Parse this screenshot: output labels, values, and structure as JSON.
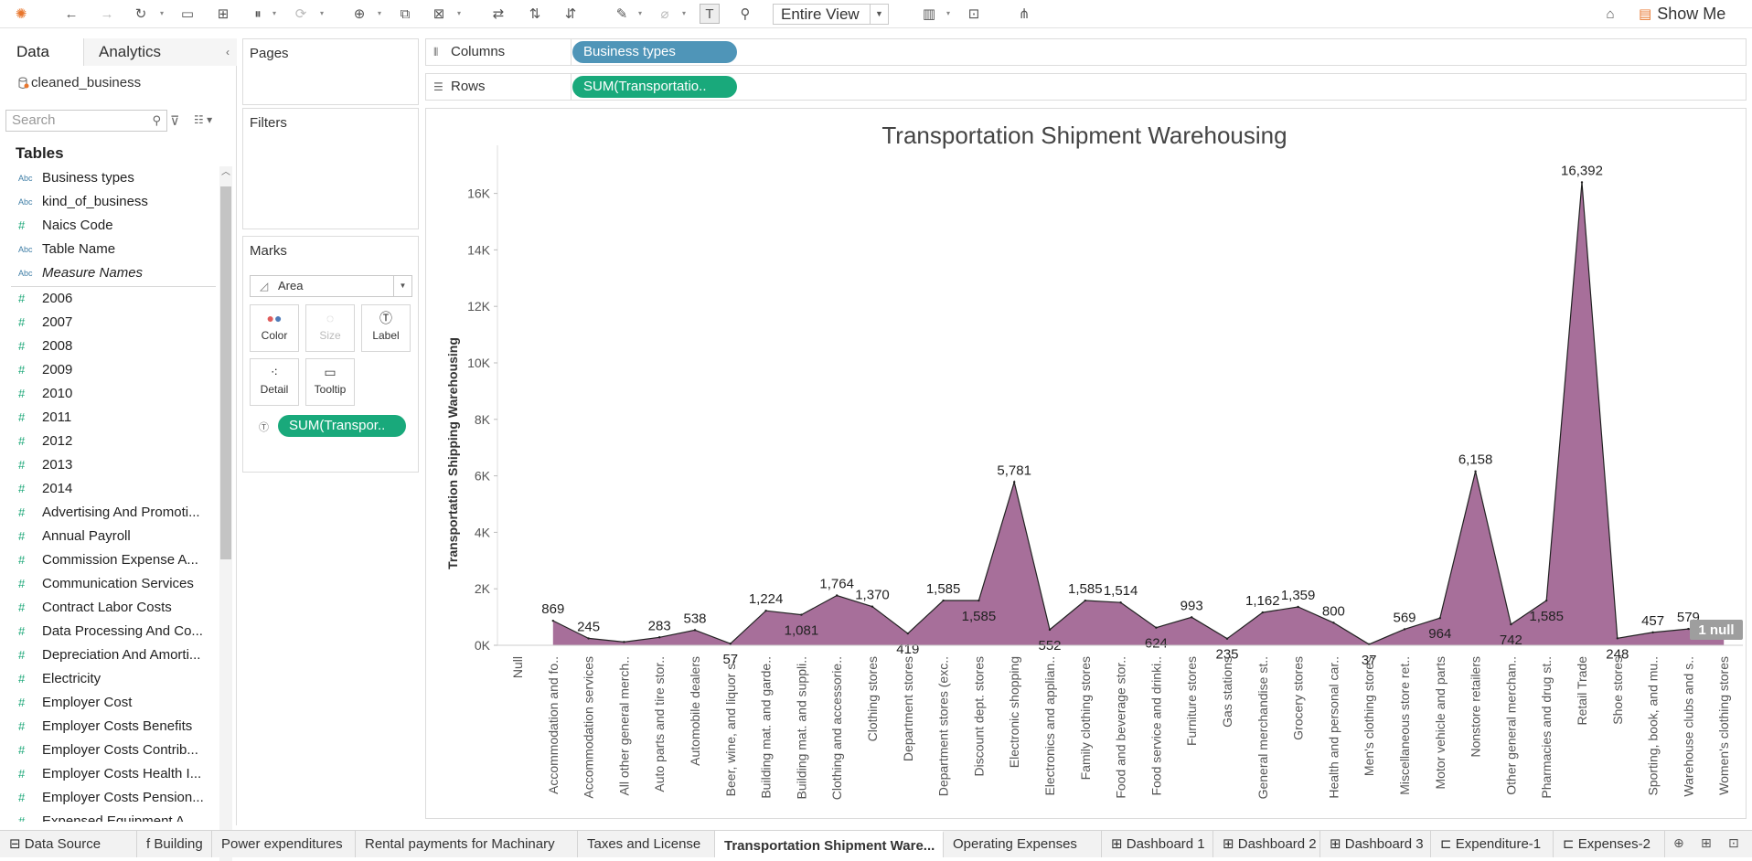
{
  "toolbar": {
    "view_select": "Entire View",
    "show_me_label": "Show Me",
    "icons": [
      "tableau-logo-icon",
      "undo-icon",
      "redo-icon",
      "replay-icon",
      "save-icon",
      "new-datasource-icon",
      "pause-update-icon",
      "refresh-icon",
      "new-worksheet-icon",
      "duplicate-icon",
      "clear-icon",
      "swap-icon",
      "sort-ascending-icon",
      "sort-descending-icon",
      "highlight-icon",
      "group-icon",
      "label-icon",
      "fix-axes-icon",
      "fit-icon",
      "show-cards-icon",
      "presentation-icon",
      "share-icon"
    ]
  },
  "left_pane": {
    "tab_data": "Data",
    "tab_analytics": "Analytics",
    "datasource": "cleaned_business",
    "search_placeholder": "Search",
    "tables_header": "Tables",
    "fields": [
      {
        "type": "Abc",
        "name": "Business types"
      },
      {
        "type": "Abc",
        "name": "kind_of_business"
      },
      {
        "type": "#",
        "name": "Naics Code"
      },
      {
        "type": "Abc",
        "name": "Table Name"
      },
      {
        "type": "Abc",
        "name": "Measure Names",
        "italic": true
      },
      {
        "type": "#",
        "name": "2006"
      },
      {
        "type": "#",
        "name": "2007"
      },
      {
        "type": "#",
        "name": "2008"
      },
      {
        "type": "#",
        "name": "2009"
      },
      {
        "type": "#",
        "name": "2010"
      },
      {
        "type": "#",
        "name": "2011"
      },
      {
        "type": "#",
        "name": "2012"
      },
      {
        "type": "#",
        "name": "2013"
      },
      {
        "type": "#",
        "name": "2014"
      },
      {
        "type": "#",
        "name": "Advertising And Promoti..."
      },
      {
        "type": "#",
        "name": "Annual Payroll"
      },
      {
        "type": "#",
        "name": "Commission Expense A..."
      },
      {
        "type": "#",
        "name": "Communication Services"
      },
      {
        "type": "#",
        "name": "Contract Labor Costs"
      },
      {
        "type": "#",
        "name": "Data Processing And Co..."
      },
      {
        "type": "#",
        "name": "Depreciation And Amorti..."
      },
      {
        "type": "#",
        "name": "Electricity"
      },
      {
        "type": "#",
        "name": "Employer Cost"
      },
      {
        "type": "#",
        "name": "Employer Costs Benefits"
      },
      {
        "type": "#",
        "name": "Employer Costs Contrib..."
      },
      {
        "type": "#",
        "name": "Employer Costs Health I..."
      },
      {
        "type": "#",
        "name": "Employer Costs Pension..."
      },
      {
        "type": "#",
        "name": "Expensed Equipment A..."
      }
    ]
  },
  "cards": {
    "pages": "Pages",
    "filters": "Filters",
    "marks": "Marks",
    "mark_type": "Area",
    "buttons": [
      "Color",
      "Size",
      "Label",
      "Detail",
      "Tooltip"
    ],
    "mark_pill": "SUM(Transpor.."
  },
  "shelves": {
    "columns_label": "Columns",
    "columns_pill": "Business types",
    "rows_label": "Rows",
    "rows_pill": "SUM(Transportatio.."
  },
  "null_badge": "1 null",
  "chart_data": {
    "type": "area",
    "title": "Transportation Shipment Warehousing",
    "ylabel": "Transportation Shipping Warehousing",
    "xlabel": "",
    "ylim": [
      0,
      17000
    ],
    "yticks": [
      "0K",
      "2K",
      "4K",
      "6K",
      "8K",
      "10K",
      "12K",
      "14K",
      "16K"
    ],
    "ytick_values": [
      0,
      2000,
      4000,
      6000,
      8000,
      10000,
      12000,
      14000,
      16000
    ],
    "fill_color": "#a76f9a",
    "stroke_color": "#222222",
    "categories": [
      "Null",
      "Accommodation and fo..",
      "Accommodation services",
      "All other general merch..",
      "Auto parts and tire stor..",
      "Automobile dealers",
      "Beer, wine, and liquor s..",
      "Building mat. and garde..",
      "Building mat. and suppli..",
      "Clothing and accessorie..",
      "Clothing stores",
      "Department stores",
      "Department stores (exc..",
      "Discount dept. stores",
      "Electronic shopping",
      "Electronics and applian..",
      "Family clothing stores",
      "Food and beverage stor..",
      "Food service and drinki..",
      "Furniture stores",
      "Gas stations",
      "General merchandise st..",
      "Grocery stores",
      "Health and personal car..",
      "Men's clothing stores",
      "Miscellaneous store ret..",
      "Motor vehicle and parts",
      "Nonstore retailers",
      "Other general merchan..",
      "Pharmacies and drug st..",
      "Retail Trade",
      "Shoe stores",
      "Sporting, book, and mu..",
      "Warehouse clubs and s..",
      "Women's clothing stores"
    ],
    "values": [
      null,
      869,
      245,
      118,
      283,
      538,
      57,
      1224,
      1081,
      1764,
      1370,
      419,
      1585,
      1585,
      5781,
      552,
      1585,
      1514,
      624,
      993,
      235,
      1162,
      1359,
      800,
      37,
      569,
      964,
      6158,
      742,
      1585,
      16392,
      248,
      457,
      579,
      579
    ],
    "labels": [
      "",
      "869",
      "245",
      "",
      "283",
      "538",
      "57",
      "1,224",
      "1,081",
      "1,764",
      "1,370",
      "419",
      "1,585",
      "1,585",
      "5,781",
      "552",
      "1,585",
      "1,514",
      "624",
      "993",
      "235",
      "1,162",
      "1,359",
      "800",
      "37",
      "569",
      "964",
      "6,158",
      "742",
      "1,585",
      "16,392",
      "248",
      "457",
      "579",
      ""
    ],
    "label_below": [
      false,
      false,
      false,
      false,
      false,
      false,
      true,
      false,
      true,
      false,
      false,
      true,
      false,
      true,
      false,
      true,
      false,
      false,
      true,
      false,
      true,
      false,
      false,
      false,
      true,
      false,
      true,
      false,
      true,
      true,
      false,
      true,
      false,
      false,
      false
    ]
  },
  "sheet_tabs": [
    "Data Source",
    "f Building",
    "Power expenditures",
    "Rental payments for Machinary",
    "Taxes and License",
    "Transportation Shipment Ware...",
    "Operating Expenses",
    "Dashboard 1",
    "Dashboard 2",
    "Dashboard 3",
    "Expenditure-1",
    "Expenses-2"
  ],
  "active_sheet": "Transportation Shipment Ware..."
}
